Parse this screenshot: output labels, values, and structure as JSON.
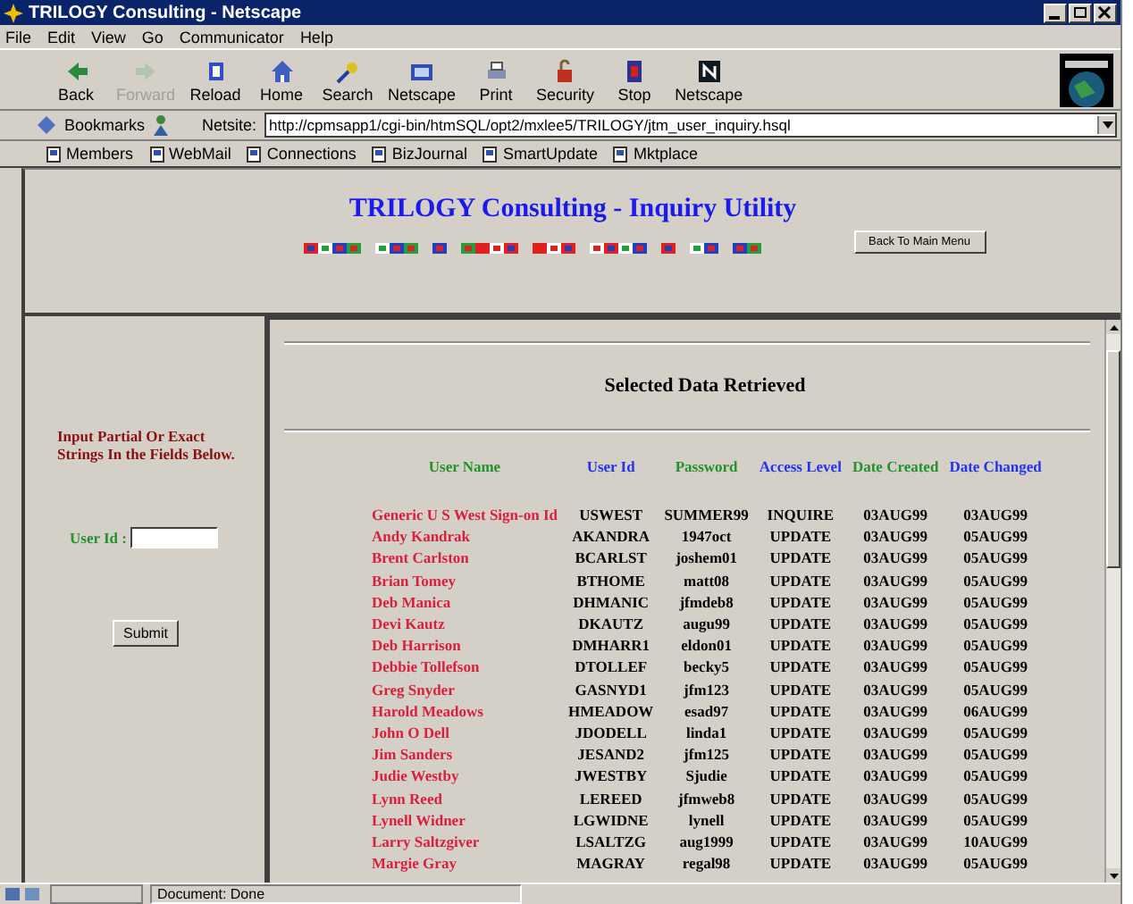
{
  "window": {
    "title": "TRILOGY Consulting - Netscape"
  },
  "menu": [
    "File",
    "Edit",
    "View",
    "Go",
    "Communicator",
    "Help"
  ],
  "toolbar": [
    {
      "label": "Back",
      "disabled": false
    },
    {
      "label": "Forward",
      "disabled": true
    },
    {
      "label": "Reload",
      "disabled": false
    },
    {
      "label": "Home",
      "disabled": false
    },
    {
      "label": "Search",
      "disabled": false
    },
    {
      "label": "Netscape",
      "disabled": false
    },
    {
      "label": "Print",
      "disabled": false
    },
    {
      "label": "Security",
      "disabled": false
    },
    {
      "label": "Stop",
      "disabled": false
    },
    {
      "label": "Netscape",
      "disabled": false
    }
  ],
  "location": {
    "bookmarks": "Bookmarks",
    "label": "Netsite:",
    "url": "http://cpmsapp1/cgi-bin/htmSQL/opt2/mxlee5/TRILOGY/jtm_user_inquiry.hsql"
  },
  "personal_toolbar": [
    "Members",
    "WebMail",
    "Connections",
    "BizJournal",
    "SmartUpdate",
    "Mktplace"
  ],
  "header": {
    "title": "TRILOGY Consulting - Inquiry Utility",
    "button": "Back To Main Menu"
  },
  "search_panel": {
    "instructions": "Input Partial Or Exact Strings In the Fields Below.",
    "field_label": "User Id :",
    "submit": "Submit"
  },
  "results": {
    "heading": "Selected Data Retrieved",
    "columns": [
      {
        "label": "User Name",
        "color": "#22922a"
      },
      {
        "label": "User Id",
        "color": "#2233ee"
      },
      {
        "label": "Password",
        "color": "#22922a"
      },
      {
        "label": "Access Level",
        "color": "#2233ee"
      },
      {
        "label": "Date Created",
        "color": "#22922a"
      },
      {
        "label": "Date Changed",
        "color": "#2233ee"
      }
    ],
    "rows": [
      [
        "Generic U S West Sign-on Id",
        "USWEST",
        "SUMMER99",
        "INQUIRE",
        "03AUG99",
        "03AUG99"
      ],
      [
        "Andy Kandrak",
        "AKANDRA",
        "1947oct",
        "UPDATE",
        "03AUG99",
        "05AUG99"
      ],
      [
        "Brent Carlston",
        "BCARLST",
        "joshem01",
        "UPDATE",
        "03AUG99",
        "05AUG99"
      ],
      [
        "Brian Tomey",
        "BTHOME",
        "matt08",
        "UPDATE",
        "03AUG99",
        "05AUG99"
      ],
      [
        "Deb Manica",
        "DHMANIC",
        "jfmdeb8",
        "UPDATE",
        "03AUG99",
        "05AUG99"
      ],
      [
        "Devi Kautz",
        "DKAUTZ",
        "augu99",
        "UPDATE",
        "03AUG99",
        "05AUG99"
      ],
      [
        "Deb Harrison",
        "DMHARR1",
        "eldon01",
        "UPDATE",
        "03AUG99",
        "05AUG99"
      ],
      [
        "Debbie Tollefson",
        "DTOLLEF",
        "becky5",
        "UPDATE",
        "03AUG99",
        "05AUG99"
      ],
      [
        "Greg Snyder",
        "GASNYD1",
        "jfm123",
        "UPDATE",
        "03AUG99",
        "05AUG99"
      ],
      [
        "Harold Meadows",
        "HMEADOW",
        "esad97",
        "UPDATE",
        "03AUG99",
        "06AUG99"
      ],
      [
        "John O Dell",
        "JDODELL",
        "linda1",
        "UPDATE",
        "03AUG99",
        "05AUG99"
      ],
      [
        "Jim Sanders",
        "JESAND2",
        "jfm125",
        "UPDATE",
        "03AUG99",
        "05AUG99"
      ],
      [
        "Judie Westby",
        "JWESTBY",
        "Sjudie",
        "UPDATE",
        "03AUG99",
        "05AUG99"
      ],
      [
        "Lynn Reed",
        "LEREED",
        "jfmweb8",
        "UPDATE",
        "03AUG99",
        "05AUG99"
      ],
      [
        "Lynell Widner",
        "LGWIDNE",
        "lynell",
        "UPDATE",
        "03AUG99",
        "05AUG99"
      ],
      [
        "Larry Saltzgiver",
        "LSALTZG",
        "aug1999",
        "UPDATE",
        "03AUG99",
        "10AUG99"
      ],
      [
        "Margie Gray",
        "MAGRAY",
        "regal98",
        "UPDATE",
        "03AUG99",
        "05AUG99"
      ]
    ]
  },
  "status_bar": "Document: Done"
}
